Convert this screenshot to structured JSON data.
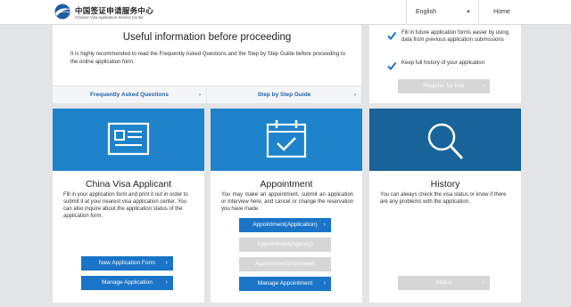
{
  "header": {
    "logo_cn": "中国签证申请服务中心",
    "logo_en": "Chinese Visa Application Service Center",
    "language": "English",
    "home": "Home"
  },
  "info": {
    "title": "Useful information before proceeding",
    "text": "It is highly recommended to read the Frequently Asked Questions and the Step by Step Guide before proceeding to the online application form.",
    "link_faq": "Frequently Asked Questions",
    "link_guide": "Step by Step Guide"
  },
  "register": {
    "benefits": [
      "Fill in future application forms easier by using data from previous application submissions",
      "Keep full history of your application"
    ],
    "button": "Register for free"
  },
  "cards": {
    "visa": {
      "title": "China Visa Applicant",
      "desc": "Fill in your application form and print it out in order to submit it at your nearest visa application center. You can also inquire about the application status of the application form.",
      "btn_new": "New Application Form",
      "btn_manage": "Manage Application"
    },
    "appointment": {
      "title": "Appointment",
      "desc": "You may make an appointment, submit an application or interview here, and cancel or change the reservation you have made.",
      "btn_application": "Appointment(Application)",
      "btn_agency": "Appointment(Agency)",
      "btn_interview": "Appointment(Interview)",
      "btn_manage": "Manage Appointment"
    },
    "history": {
      "title": "History",
      "desc": "You can always check the visa status or know if there are any problems with the application.",
      "btn_status": "Status"
    }
  },
  "colors": {
    "primary_blue": "#1a74c8",
    "banner_blue": "#1f83cc",
    "history_banner": "#17639a",
    "link_blue": "#1f63a8",
    "disabled_gray": "#d6d6d6"
  },
  "icons": {
    "logo": "globe-swoosh-icon",
    "visa": "id-card-icon",
    "appointment": "calendar-check-icon",
    "history": "magnifier-icon",
    "check": "check-icon",
    "arrow": "chevron-right-icon",
    "dropdown": "chevron-down-icon"
  }
}
